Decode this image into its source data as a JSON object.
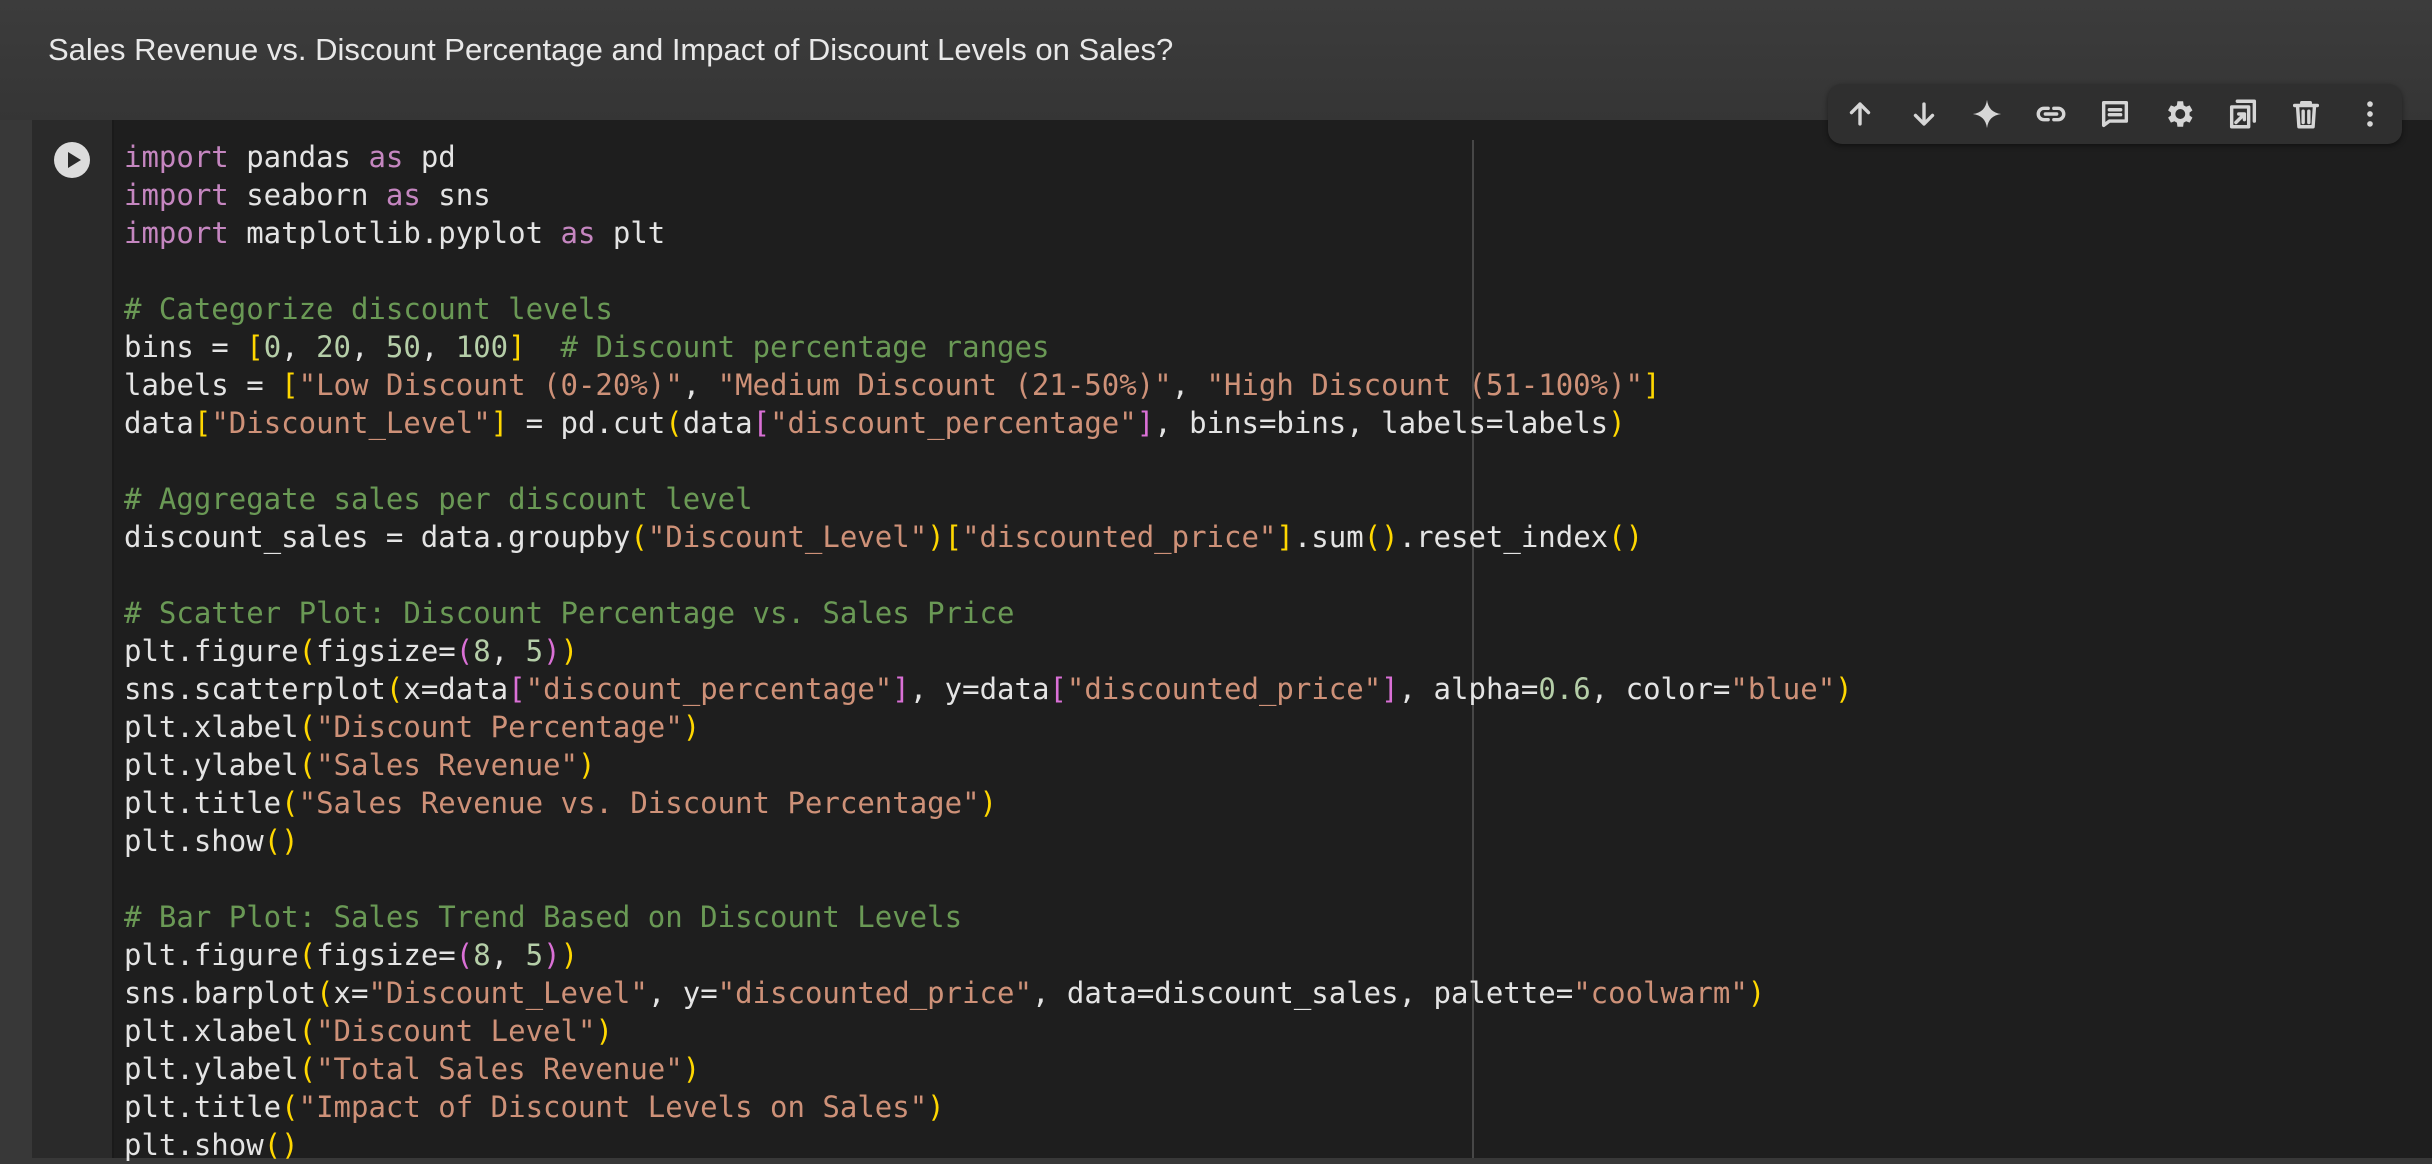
{
  "cell": {
    "title": "Sales Revenue vs. Discount Percentage and Impact of Discount Levels on Sales?"
  },
  "toolbar": {
    "items": [
      {
        "name": "move-up",
        "icon": "arrow-up-icon"
      },
      {
        "name": "move-down",
        "icon": "arrow-down-icon"
      },
      {
        "name": "ai-assist",
        "icon": "sparkle-icon"
      },
      {
        "name": "copy-link",
        "icon": "link-icon"
      },
      {
        "name": "add-comment",
        "icon": "comment-icon"
      },
      {
        "name": "settings",
        "icon": "gear-icon"
      },
      {
        "name": "mirror-cell",
        "icon": "mirror-icon"
      },
      {
        "name": "delete",
        "icon": "trash-icon"
      },
      {
        "name": "more",
        "icon": "more-vert-icon"
      }
    ]
  },
  "run_button": {
    "icon": "play-icon"
  },
  "colors": {
    "keyword": "#c586c0",
    "comment": "#6a9955",
    "string": "#ce9178",
    "number": "#b5cea8",
    "bracket_outer": "#ffd700",
    "bracket_inner": "#da70d6",
    "text": "#e4e4e4"
  },
  "code": {
    "lines": [
      [
        [
          "kw",
          "import"
        ],
        [
          "",
          " pandas "
        ],
        [
          "kw",
          "as"
        ],
        [
          "",
          " pd"
        ]
      ],
      [
        [
          "kw",
          "import"
        ],
        [
          "",
          " seaborn "
        ],
        [
          "kw",
          "as"
        ],
        [
          "",
          " sns"
        ]
      ],
      [
        [
          "kw",
          "import"
        ],
        [
          "",
          " matplotlib.pyplot "
        ],
        [
          "kw",
          "as"
        ],
        [
          "",
          " plt"
        ]
      ],
      [],
      [
        [
          "cm",
          "# Categorize discount levels"
        ]
      ],
      [
        [
          "",
          "bins = "
        ],
        [
          "b1",
          "["
        ],
        [
          "nu",
          "0"
        ],
        [
          "",
          ", "
        ],
        [
          "nu",
          "20"
        ],
        [
          "",
          ", "
        ],
        [
          "nu",
          "50"
        ],
        [
          "",
          ", "
        ],
        [
          "nu",
          "100"
        ],
        [
          "b1",
          "]"
        ],
        [
          "",
          "  "
        ],
        [
          "cm",
          "# Discount percentage ranges"
        ]
      ],
      [
        [
          "",
          "labels = "
        ],
        [
          "b1",
          "["
        ],
        [
          "st",
          "\"Low Discount (0-20%)\""
        ],
        [
          "",
          ", "
        ],
        [
          "st",
          "\"Medium Discount (21-50%)\""
        ],
        [
          "",
          ", "
        ],
        [
          "st",
          "\"High Discount (51-100%)\""
        ],
        [
          "b1",
          "]"
        ]
      ],
      [
        [
          "",
          "data"
        ],
        [
          "b1",
          "["
        ],
        [
          "st",
          "\"Discount_Level\""
        ],
        [
          "b1",
          "]"
        ],
        [
          "",
          ""
        ],
        [
          "",
          ""
        ],
        [
          "",
          " = pd.cut"
        ],
        [
          "b1",
          "("
        ],
        [
          "",
          "data"
        ],
        [
          "b2",
          "["
        ],
        [
          "st",
          "\"discount_percentage\""
        ],
        [
          "b2",
          "]"
        ],
        [
          "",
          ", bins=bins, labels=labels"
        ],
        [
          "b1",
          ")"
        ]
      ],
      [],
      [
        [
          "cm",
          "# Aggregate sales per discount level"
        ]
      ],
      [
        [
          "",
          "discount_sales = data.groupby"
        ],
        [
          "b1",
          "("
        ],
        [
          "st",
          "\"Discount_Level\""
        ],
        [
          "b1",
          ")"
        ],
        [
          "b1",
          "["
        ],
        [
          "st",
          "\"discounted_price\""
        ],
        [
          "b1",
          "]"
        ],
        [
          "",
          ".sum"
        ],
        [
          "b1",
          "()"
        ],
        [
          "",
          ".reset_index"
        ],
        [
          "b1",
          "()"
        ]
      ],
      [],
      [
        [
          "cm",
          "# Scatter Plot: Discount Percentage vs. Sales Price"
        ]
      ],
      [
        [
          "",
          "plt.figure"
        ],
        [
          "b1",
          "("
        ],
        [
          "",
          "figsize="
        ],
        [
          "b2",
          "("
        ],
        [
          "nu",
          "8"
        ],
        [
          "",
          ", "
        ],
        [
          "nu",
          "5"
        ],
        [
          "b2",
          ")"
        ],
        [
          "b1",
          ")"
        ]
      ],
      [
        [
          "",
          "sns.scatterplot"
        ],
        [
          "b1",
          "("
        ],
        [
          "",
          "x=data"
        ],
        [
          "b2",
          "["
        ],
        [
          "st",
          "\"discount_percentage\""
        ],
        [
          "b2",
          "]"
        ],
        [
          "",
          ", y=data"
        ],
        [
          "b2",
          "["
        ],
        [
          "st",
          "\"discounted_price\""
        ],
        [
          "b2",
          "]"
        ],
        [
          "",
          ", alpha="
        ],
        [
          "nu",
          "0.6"
        ],
        [
          "",
          ", color="
        ],
        [
          "st",
          "\"blue\""
        ],
        [
          "b1",
          ")"
        ]
      ],
      [
        [
          "",
          "plt.xlabel"
        ],
        [
          "b1",
          "("
        ],
        [
          "st",
          "\"Discount Percentage\""
        ],
        [
          "b1",
          ")"
        ]
      ],
      [
        [
          "",
          "plt.ylabel"
        ],
        [
          "b1",
          "("
        ],
        [
          "st",
          "\"Sales Revenue\""
        ],
        [
          "b1",
          ")"
        ]
      ],
      [
        [
          "",
          "plt.title"
        ],
        [
          "b1",
          "("
        ],
        [
          "st",
          "\"Sales Revenue vs. Discount Percentage\""
        ],
        [
          "b1",
          ")"
        ]
      ],
      [
        [
          "",
          "plt.show"
        ],
        [
          "b1",
          "()"
        ]
      ],
      [],
      [
        [
          "cm",
          "# Bar Plot: Sales Trend Based on Discount Levels"
        ]
      ],
      [
        [
          "",
          "plt.figure"
        ],
        [
          "b1",
          "("
        ],
        [
          "",
          "figsize="
        ],
        [
          "b2",
          "("
        ],
        [
          "nu",
          "8"
        ],
        [
          "",
          ", "
        ],
        [
          "nu",
          "5"
        ],
        [
          "b2",
          ")"
        ],
        [
          "b1",
          ")"
        ]
      ],
      [
        [
          "",
          "sns.barplot"
        ],
        [
          "b1",
          "("
        ],
        [
          "",
          "x="
        ],
        [
          "st",
          "\"Discount_Level\""
        ],
        [
          "",
          ", y="
        ],
        [
          "st",
          "\"discounted_price\""
        ],
        [
          "",
          ", data=discount_sales, palette="
        ],
        [
          "st",
          "\"coolwarm\""
        ],
        [
          "b1",
          ")"
        ]
      ],
      [
        [
          "",
          "plt.xlabel"
        ],
        [
          "b1",
          "("
        ],
        [
          "st",
          "\"Discount Level\""
        ],
        [
          "b1",
          ")"
        ]
      ],
      [
        [
          "",
          "plt.ylabel"
        ],
        [
          "b1",
          "("
        ],
        [
          "st",
          "\"Total Sales Revenue\""
        ],
        [
          "b1",
          ")"
        ]
      ],
      [
        [
          "",
          "plt.title"
        ],
        [
          "b1",
          "("
        ],
        [
          "st",
          "\"Impact of Discount Levels on Sales\""
        ],
        [
          "b1",
          ")"
        ]
      ],
      [
        [
          "",
          "plt.show"
        ],
        [
          "b1",
          "()"
        ]
      ]
    ]
  }
}
